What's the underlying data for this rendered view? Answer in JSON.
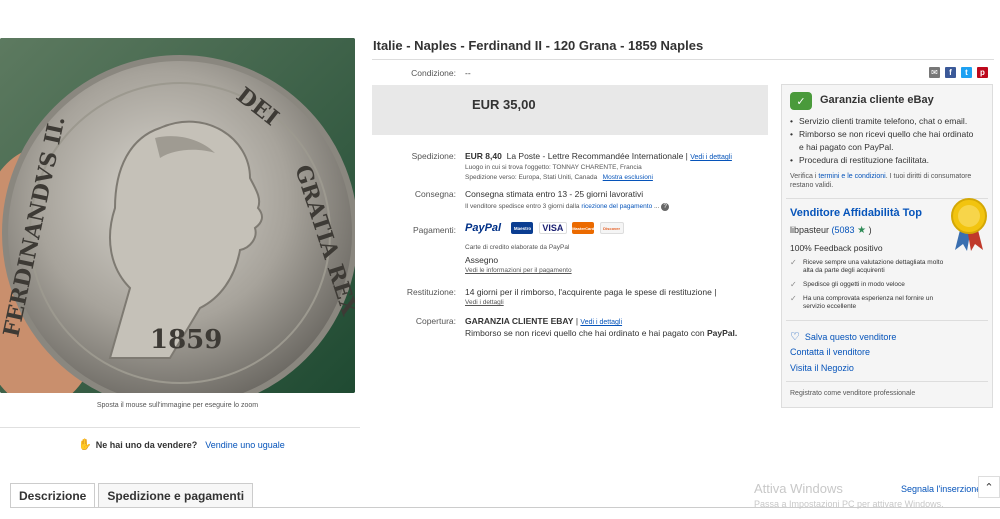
{
  "item": {
    "title": "Italie - Naples - Ferdinand II - 120 Grana - 1859 Naples",
    "zoom_hint": "Sposta il mouse sull'immagine per eseguire lo zoom",
    "coin_legend": "FERDINANDVS II. DEI GRATIA REX",
    "coin_year": "1859"
  },
  "sell_one": {
    "question": "Ne hai uno da vendere?",
    "link": "Vendine uno uguale"
  },
  "tabs": [
    "Descrizione",
    "Spedizione e pagamenti"
  ],
  "details": {
    "condition_label": "Condizione:",
    "condition_value": "--",
    "price": "EUR 35,00",
    "shipping_label": "Spedizione:",
    "shipping_cost": "EUR 8,40",
    "shipping_method": "La Poste - Lettre Recommandée Internationale",
    "shipping_link": "Vedi i dettagli",
    "location_text": "Luogo in cui si trova l'oggetto: TONNAY CHARENTE, Francia",
    "ships_to_text": "Spedizione verso: Europa, Stati Uniti, Canada",
    "exclusions_link": "Mostra esclusioni",
    "delivery_label": "Consegna:",
    "delivery_value": "Consegna stimata entro 13 - 25 giorni lavorativi",
    "delivery_note": "Il venditore spedisce entro 3 giorni dalla",
    "delivery_note_link": "ricezione del pagamento",
    "payments_label": "Pagamenti:",
    "payment_logos": [
      "PayPal",
      "Maestro",
      "VISA",
      "MasterCard",
      "Discover"
    ],
    "cards_text": "Carte di credito elaborate da PayPal",
    "cheque": "Assegno",
    "payment_details_link": "Vedi le informazioni per il pagamento",
    "returns_label": "Restituzione:",
    "returns_value": "14 giorni per il rimborso, l'acquirente paga le spese di restituzione |",
    "returns_link": "Vedi i dettagli",
    "coverage_label": "Copertura:",
    "coverage_value": "GARANZIA CLIENTE EBAY",
    "coverage_link": "Vedi i dettagli",
    "coverage_text": "Rimborso se non ricevi quello che hai ordinato e hai pagato con",
    "coverage_paypal": "PayPal."
  },
  "guarantee": {
    "title": "Garanzia cliente eBay",
    "bullets": [
      "Servizio clienti tramite telefono, chat o email.",
      "Rimborso se non ricevi quello che hai ordinato e hai pagato con PayPal.",
      "Procedura di restituzione facilitata."
    ],
    "verify_prefix": "Verifica i",
    "verify_link": "termini e le condizioni",
    "verify_suffix": ". I tuoi diritti di consumatore restano validi."
  },
  "seller": {
    "badge": "Venditore Affidabilità Top",
    "name": "libpasteur",
    "score": "(5083",
    "score_close": ")",
    "feedback": "100% Feedback positivo",
    "checks": [
      "Riceve sempre una valutazione dettagliata molto alta da parte degli acquirenti",
      "Spedisce gli oggetti in modo veloce",
      "Ha una comprovata esperienza nel fornire un servizio eccellente"
    ],
    "save": "Salva questo venditore",
    "contact": "Contatta il venditore",
    "store": "Visita il Negozio",
    "registered": "Registrato come venditore professionale"
  },
  "footer": {
    "report": "Segnala l'inserzione",
    "watermark_title": "Attiva Windows",
    "watermark_sub": "Passa a Impostazioni PC per attivare Windows."
  },
  "colors": {
    "link": "#0654ba",
    "paypal_blue": "#003087",
    "paypal_light": "#009cde",
    "price_box": "#e8e8e8",
    "email": "#555555",
    "facebook": "#3b5998",
    "twitter": "#1da1f2",
    "pinterest": "#bd081c"
  },
  "icons": [
    "email-icon",
    "facebook-icon",
    "twitter-icon",
    "pinterest-icon",
    "guarantee-shield-icon",
    "top-rated-ribbon-icon",
    "star-icon",
    "heart-icon",
    "check-icon",
    "help-icon",
    "sell-hand-icon",
    "chevron-up-icon"
  ]
}
